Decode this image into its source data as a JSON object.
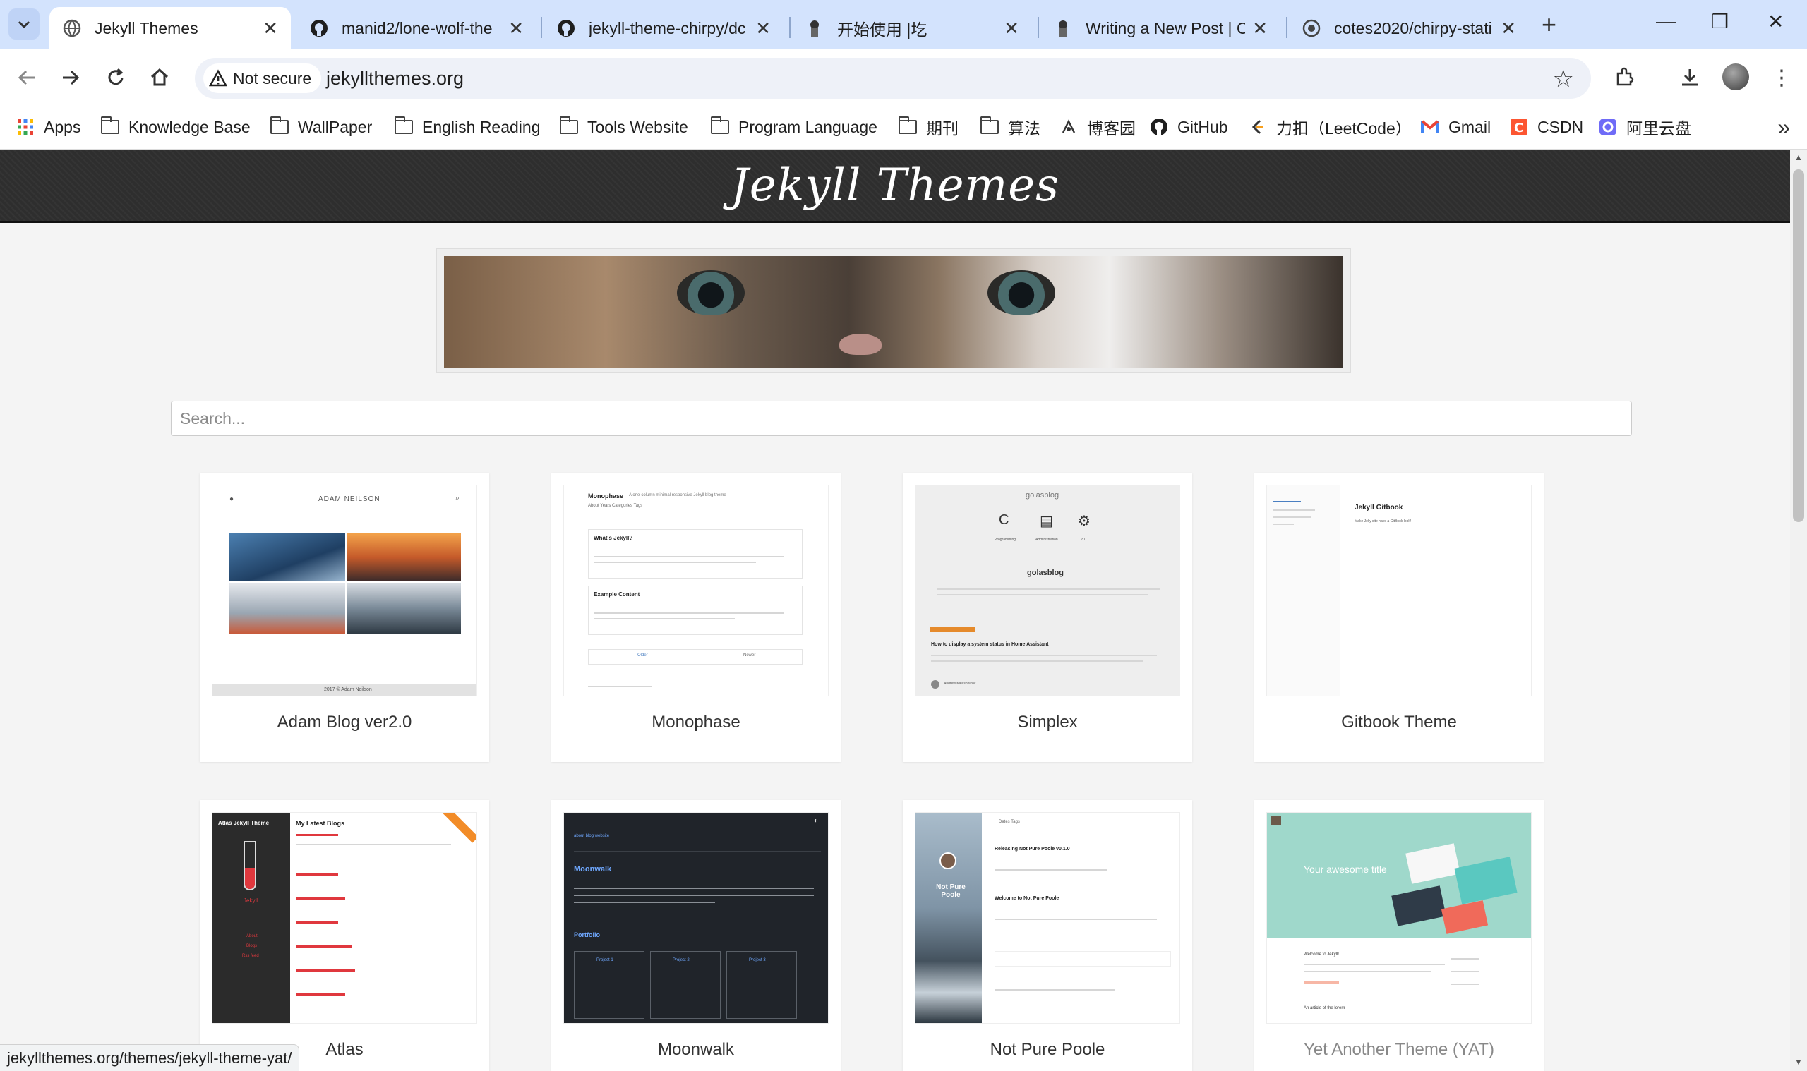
{
  "browser": {
    "tabs": [
      {
        "title": "Jekyll Themes",
        "icon": "globe-icon",
        "active": true
      },
      {
        "title": "manid2/lone-wolf-the",
        "icon": "github-icon",
        "active": false
      },
      {
        "title": "jekyll-theme-chirpy/dc",
        "icon": "github-icon",
        "active": false
      },
      {
        "title": "开始使用 |圪",
        "icon": "ninja-icon",
        "active": false
      },
      {
        "title": "Writing a New Post | C",
        "icon": "ninja-icon",
        "active": false
      },
      {
        "title": "cotes2020/chirpy-stati",
        "icon": "github-icon",
        "active": false
      }
    ],
    "new_tab": "+",
    "security_label": "Not secure",
    "url": "jekyllthemes.org",
    "bookmarks": [
      {
        "label": "Apps",
        "icon": "apps-grid-icon"
      },
      {
        "label": "Knowledge Base",
        "icon": "folder-icon"
      },
      {
        "label": "WallPaper",
        "icon": "folder-icon"
      },
      {
        "label": "English Reading",
        "icon": "folder-icon"
      },
      {
        "label": "Tools Website",
        "icon": "folder-icon"
      },
      {
        "label": "Program Language",
        "icon": "folder-icon"
      },
      {
        "label": "期刊",
        "icon": "folder-icon"
      },
      {
        "label": "算法",
        "icon": "folder-icon"
      },
      {
        "label": "博客园",
        "icon": "cnblogs-icon"
      },
      {
        "label": "GitHub",
        "icon": "github-icon"
      },
      {
        "label": "力扣（LeetCode）",
        "icon": "leetcode-icon"
      },
      {
        "label": "Gmail",
        "icon": "gmail-icon"
      },
      {
        "label": "CSDN",
        "icon": "csdn-icon"
      },
      {
        "label": "阿里云盘",
        "icon": "aliyun-drive-icon"
      }
    ],
    "status_url": "jekyllthemes.org/themes/jekyll-theme-yat/"
  },
  "site": {
    "title": "Jekyll Themes",
    "search_placeholder": "Search..."
  },
  "themes": [
    {
      "name": "Adam Blog ver2.0"
    },
    {
      "name": "Monophase"
    },
    {
      "name": "Simplex"
    },
    {
      "name": "Gitbook Theme"
    },
    {
      "name": "Atlas"
    },
    {
      "name": "Moonwalk"
    },
    {
      "name": "Not Pure Poole"
    },
    {
      "name": "Yet Another Theme (YAT)"
    }
  ],
  "thumbs": {
    "adam": {
      "brand": "ADAM NEILSON",
      "footer": "2017 © Adam Neilson"
    },
    "monophase": {
      "heading": "Monophase",
      "tagline": "A one-column minimal responsive Jekyll blog theme",
      "nav": "About   Years   Categories   Tags",
      "post1": "What's Jekyll?",
      "post2": "Example Content",
      "older": "Older",
      "newer": "Newer"
    },
    "simplex": {
      "brand": "golasblog",
      "post": "How to display a system status in Home Assistant",
      "tag1": "Programming",
      "tag2": "Administration",
      "tag3": "IoT",
      "author": "Andrew Kalashnikov"
    },
    "gitbook": {
      "heading": "Jekyll Gitbook",
      "sub": "Make Jelly site have a GitBook look!"
    },
    "atlas": {
      "brand": "Atlas Jekyll Theme",
      "heading": "My Latest Blogs",
      "side": "Jekyll",
      "links": [
        "About",
        "Blogs",
        "Rss feed"
      ]
    },
    "moonwalk": {
      "nav": "about   blog   website",
      "heading": "Moonwalk",
      "portfolio": "Portfolio",
      "p1": "Project 1",
      "p2": "Project 2",
      "p3": "Project 3"
    },
    "poole": {
      "brand": "Not Pure Poole",
      "nav": "Dates   Tags",
      "post1": "Releasing Not Pure Poole v0.1.0",
      "post2": "Welcome to Not Pure Poole"
    },
    "yat": {
      "hero": "Your awesome title",
      "post": "Welcome to Jekyll!",
      "post2": "An article of the lorem"
    }
  },
  "colors": {
    "tabstrip": "#d3e3fd",
    "header_bg": "#2e2e2e",
    "page_bg": "#f4f4f4",
    "atlas_red": "#e0383e",
    "moonwalk_bg": "#20242a",
    "yat_teal": "#9fd8cb"
  }
}
